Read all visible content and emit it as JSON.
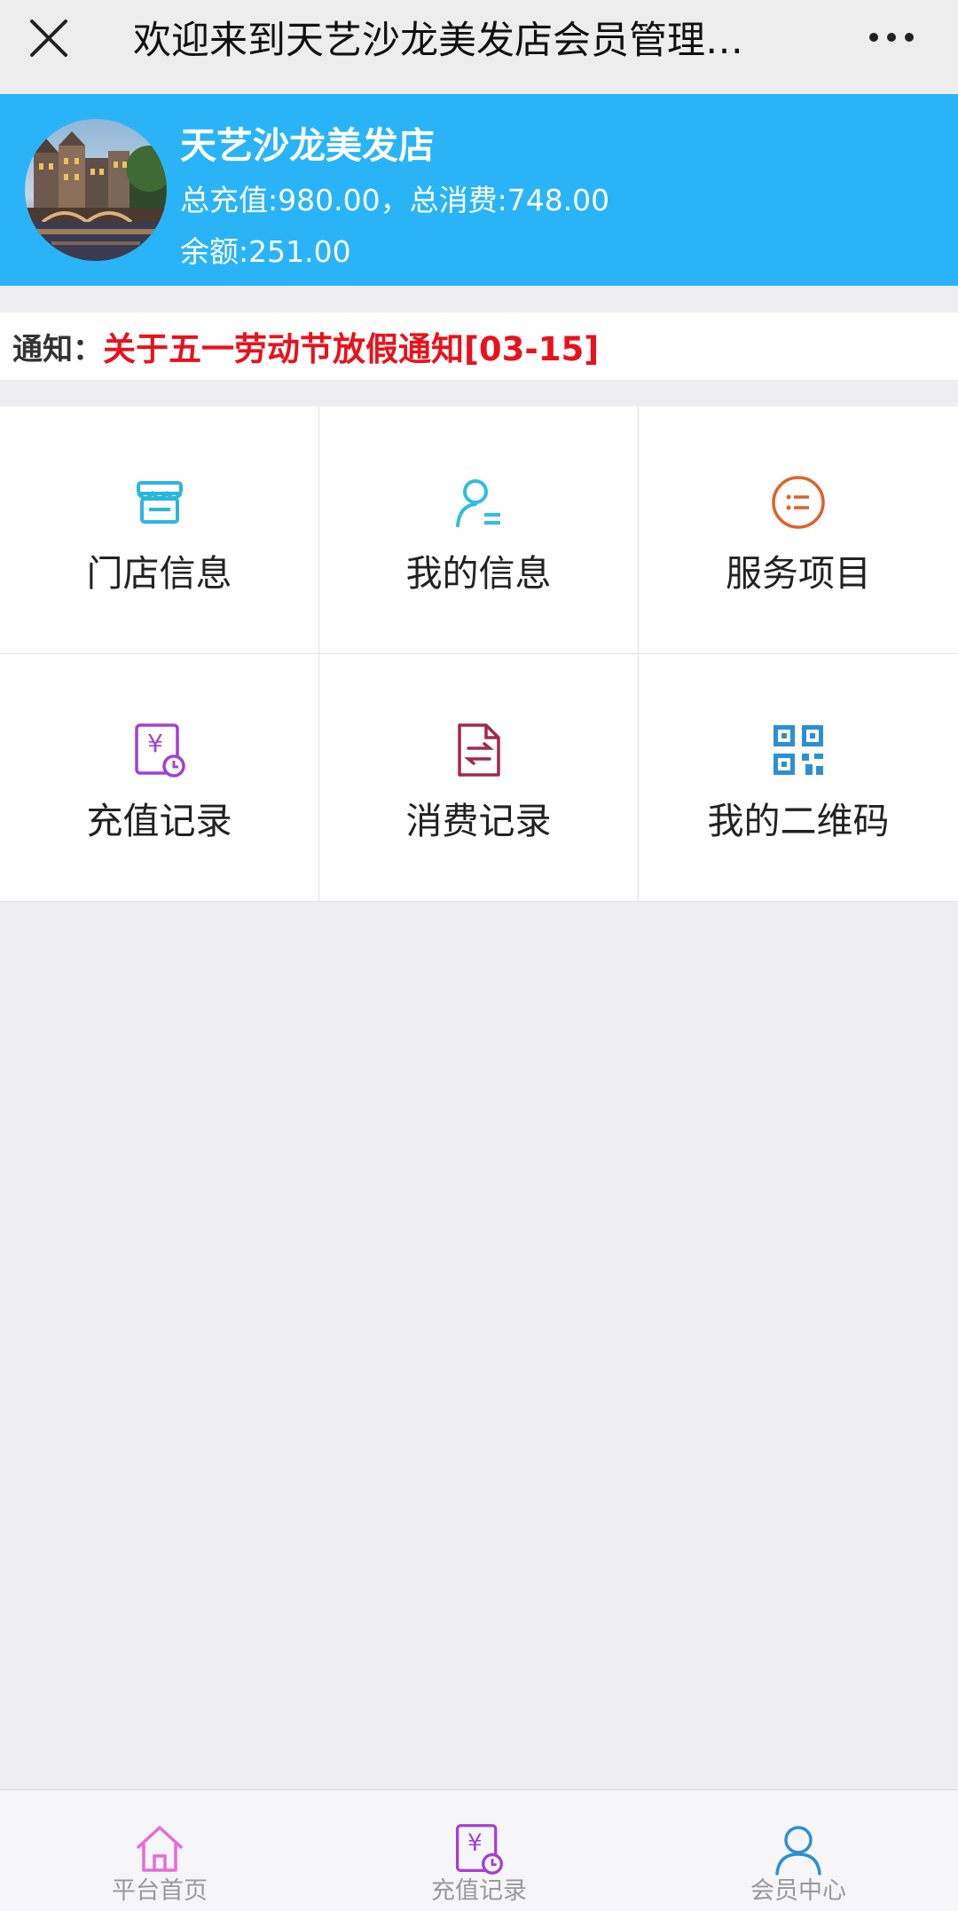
{
  "nav": {
    "title": "欢迎来到天艺沙龙美发店会员管理…",
    "close_icon": "close-icon",
    "more_icon": "more-icon"
  },
  "header": {
    "shop_name": "天艺沙龙美发店",
    "stats": "总充值:980.00，总消费:748.00",
    "balance": "余额:251.00",
    "brand_color": "#2ab4f7"
  },
  "notice": {
    "label": "通知：",
    "text": "关于五一劳动节放假通知[03-15]",
    "text_color": "#e8121c"
  },
  "grid": {
    "items": [
      {
        "label": "门店信息",
        "icon": "store-icon",
        "color": "#29b6e0"
      },
      {
        "label": "我的信息",
        "icon": "user-info-icon",
        "color": "#2cc0dc"
      },
      {
        "label": "服务项目",
        "icon": "service-list-icon",
        "color": "#e0602a"
      },
      {
        "label": "充值记录",
        "icon": "recharge-record-icon",
        "color": "#a43fd1"
      },
      {
        "label": "消费记录",
        "icon": "consume-record-icon",
        "color": "#a3284d"
      },
      {
        "label": "我的二维码",
        "icon": "qrcode-icon",
        "color": "#2c8fd6"
      }
    ]
  },
  "tabbar": {
    "items": [
      {
        "label": "平台首页",
        "icon": "home-icon",
        "color": "#e86ad8"
      },
      {
        "label": "充值记录",
        "icon": "recharge-icon",
        "color": "#a43fd1"
      },
      {
        "label": "会员中心",
        "icon": "member-icon",
        "color": "#2c8fd6"
      }
    ]
  }
}
